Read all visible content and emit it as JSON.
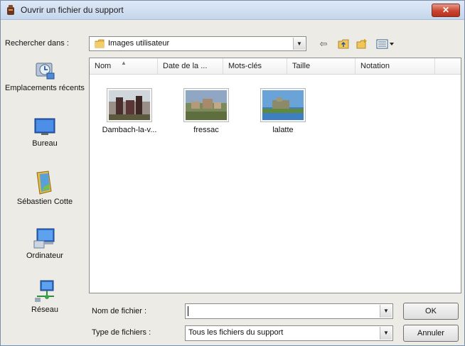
{
  "window": {
    "title": "Ouvrir un fichier du support",
    "close_label": "✕"
  },
  "lookin": {
    "label": "Rechercher dans :",
    "value": "Images utilisateur"
  },
  "toolbar": {
    "back_glyph": "⇦",
    "up_glyph": "⇧",
    "newfolder_glyph": "✱",
    "views_glyph": "☷"
  },
  "places": [
    {
      "label": "Emplacements récents",
      "icon": "recent-places-icon"
    },
    {
      "label": "Bureau",
      "icon": "desktop-icon"
    },
    {
      "label": "Sébastien Cotte",
      "icon": "user-folder-icon"
    },
    {
      "label": "Ordinateur",
      "icon": "computer-icon"
    },
    {
      "label": "Réseau",
      "icon": "network-icon"
    }
  ],
  "columns": [
    "Nom",
    "Date de la ...",
    "Mots-clés",
    "Taille",
    "Notation"
  ],
  "files": [
    {
      "name": "Dambach-la-v...",
      "thumb": "castle-photo-thumbnail"
    },
    {
      "name": "fressac",
      "thumb": "village-photo-thumbnail"
    },
    {
      "name": "lalatte",
      "thumb": "fort-photo-thumbnail"
    }
  ],
  "filename": {
    "label": "Nom de fichier :",
    "value": ""
  },
  "filetype": {
    "label": "Type de fichiers :",
    "value": "Tous les fichiers du support"
  },
  "buttons": {
    "ok": "OK",
    "cancel": "Annuler"
  },
  "colors": {
    "title_bar": "#c5d6ec",
    "close_button": "#c9452f",
    "dialog_bg": "#ecebe6"
  }
}
